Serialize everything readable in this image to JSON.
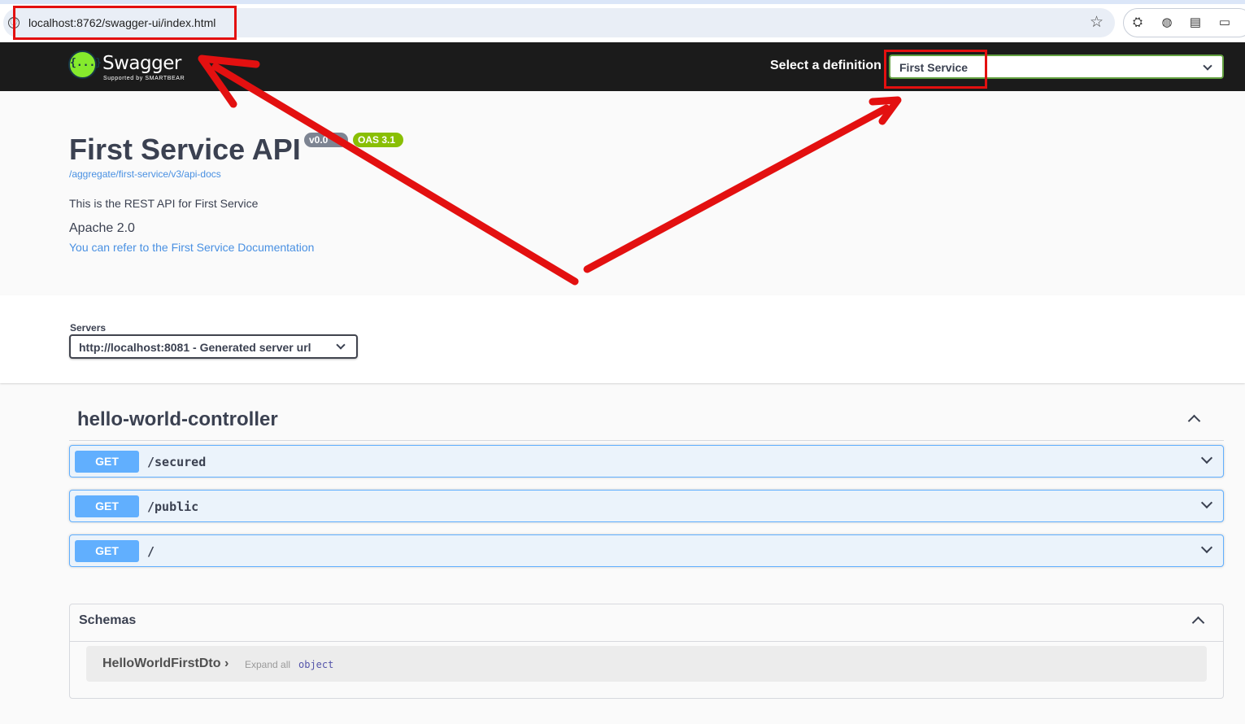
{
  "browser": {
    "url": "localhost:8762/swagger-ui/index.html",
    "site_info_glyph": "ⓘ",
    "bookmark_glyph": "☆",
    "extension_glyphs": [
      "⛭",
      "◍",
      "▤",
      "▭"
    ]
  },
  "topbar": {
    "logo_glyph": "{...}",
    "logo_name": "Swagger",
    "logo_tagline": "Supported by SMARTBEAR",
    "definition_label": "Select a definition",
    "definition_selected": "First Service"
  },
  "info": {
    "title": "First Service API",
    "version_badge": "v0.0",
    "oas_badge": "OAS 3.1",
    "spec_link": "/aggregate/first-service/v3/api-docs",
    "description": "This is the REST API for First Service",
    "license": "Apache 2.0",
    "docs_link": "You can refer to the First Service Documentation"
  },
  "servers": {
    "label": "Servers",
    "selected": "http://localhost:8081 - Generated server url"
  },
  "controller": {
    "name": "hello-world-controller",
    "operations": [
      {
        "method": "GET",
        "path": "/secured"
      },
      {
        "method": "GET",
        "path": "/public"
      },
      {
        "method": "GET",
        "path": "/"
      }
    ]
  },
  "schemas": {
    "title": "Schemas",
    "models": [
      {
        "name": "HelloWorldFirstDto",
        "arrow": "›",
        "expand_label": "Expand all",
        "type": "object"
      }
    ]
  },
  "colors": {
    "topbar_bg": "#1b1b1b",
    "get_method": "#61affe",
    "get_block_bg": "#ebf3fb",
    "link": "#4990e2",
    "annotation_red": "#e31010",
    "logo_green": "#85ea2d"
  }
}
